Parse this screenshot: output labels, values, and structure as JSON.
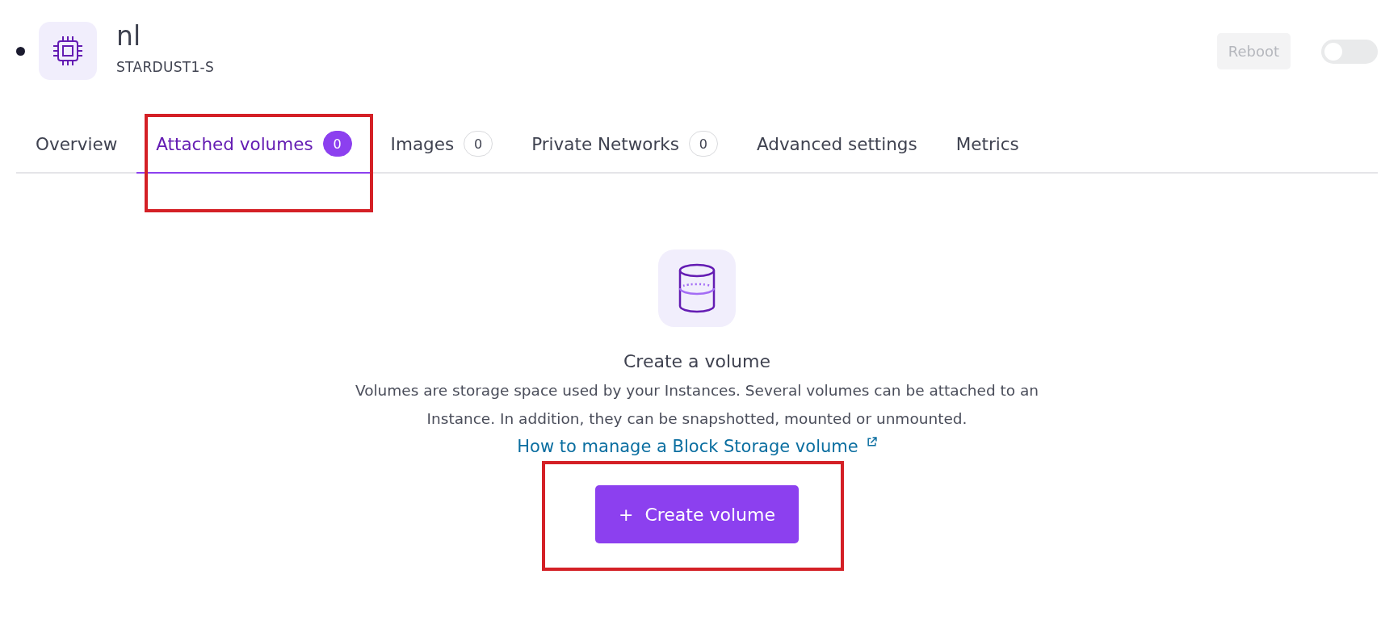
{
  "instance": {
    "name": "nl",
    "type": "STARDUST1-S",
    "reboot": {
      "label": "Reboot",
      "disabled": true
    },
    "power_on": false
  },
  "tabs": [
    {
      "label": "Overview",
      "selected": false,
      "highlighted": false
    },
    {
      "label": "Attached volumes",
      "count": "0",
      "selected": true,
      "highlighted": true
    },
    {
      "label": "Images",
      "count": "0",
      "selected": false,
      "highlighted": false
    },
    {
      "label": "Private Networks",
      "count": "0",
      "selected": false,
      "highlighted": false
    },
    {
      "label": "Advanced settings",
      "selected": false,
      "highlighted": false
    },
    {
      "label": "Metrics",
      "selected": false,
      "highlighted": false
    }
  ],
  "empty_state": {
    "title": "Create a volume",
    "description": "Volumes are storage space used by your Instances. Several volumes can be attached to an Instance. In addition, they can be snapshotted, mounted or unmounted.",
    "link": "How to manage a Block Storage volume",
    "button": {
      "icon": "+",
      "label": "Create volume",
      "highlighted": true
    }
  }
}
